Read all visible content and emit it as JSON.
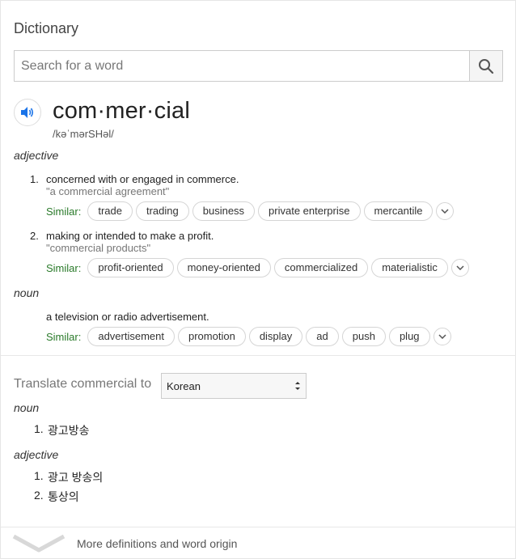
{
  "title": "Dictionary",
  "search": {
    "placeholder": "Search for a word",
    "value": ""
  },
  "entry": {
    "word": "com·mer·cial",
    "pronunciation": "/kəˈmərSHəl/"
  },
  "senses": {
    "adjective": {
      "label": "adjective",
      "defs": [
        {
          "num": "1.",
          "text": "concerned with or engaged in commerce.",
          "example": "\"a commercial agreement\"",
          "similar_label": "Similar:",
          "similar": [
            "trade",
            "trading",
            "business",
            "private enterprise",
            "mercantile"
          ]
        },
        {
          "num": "2.",
          "text": "making or intended to make a profit.",
          "example": "\"commercial products\"",
          "similar_label": "Similar:",
          "similar": [
            "profit-oriented",
            "money-oriented",
            "commercialized",
            "materialistic"
          ]
        }
      ]
    },
    "noun": {
      "label": "noun",
      "defs": [
        {
          "text": "a television or radio advertisement.",
          "similar_label": "Similar:",
          "similar": [
            "advertisement",
            "promotion",
            "display",
            "ad",
            "push",
            "plug"
          ]
        }
      ]
    }
  },
  "translate": {
    "label": "Translate commercial to",
    "language": "Korean",
    "noun_label": "noun",
    "noun_items": [
      {
        "num": "1.",
        "text": "광고방송"
      }
    ],
    "adjective_label": "adjective",
    "adjective_items": [
      {
        "num": "1.",
        "text": "광고 방송의"
      },
      {
        "num": "2.",
        "text": "통상의"
      }
    ]
  },
  "footer": {
    "more_label": "More definitions and word origin"
  },
  "colors": {
    "similar_label": "#2a7a2a",
    "speaker_icon": "#1a73e8"
  }
}
